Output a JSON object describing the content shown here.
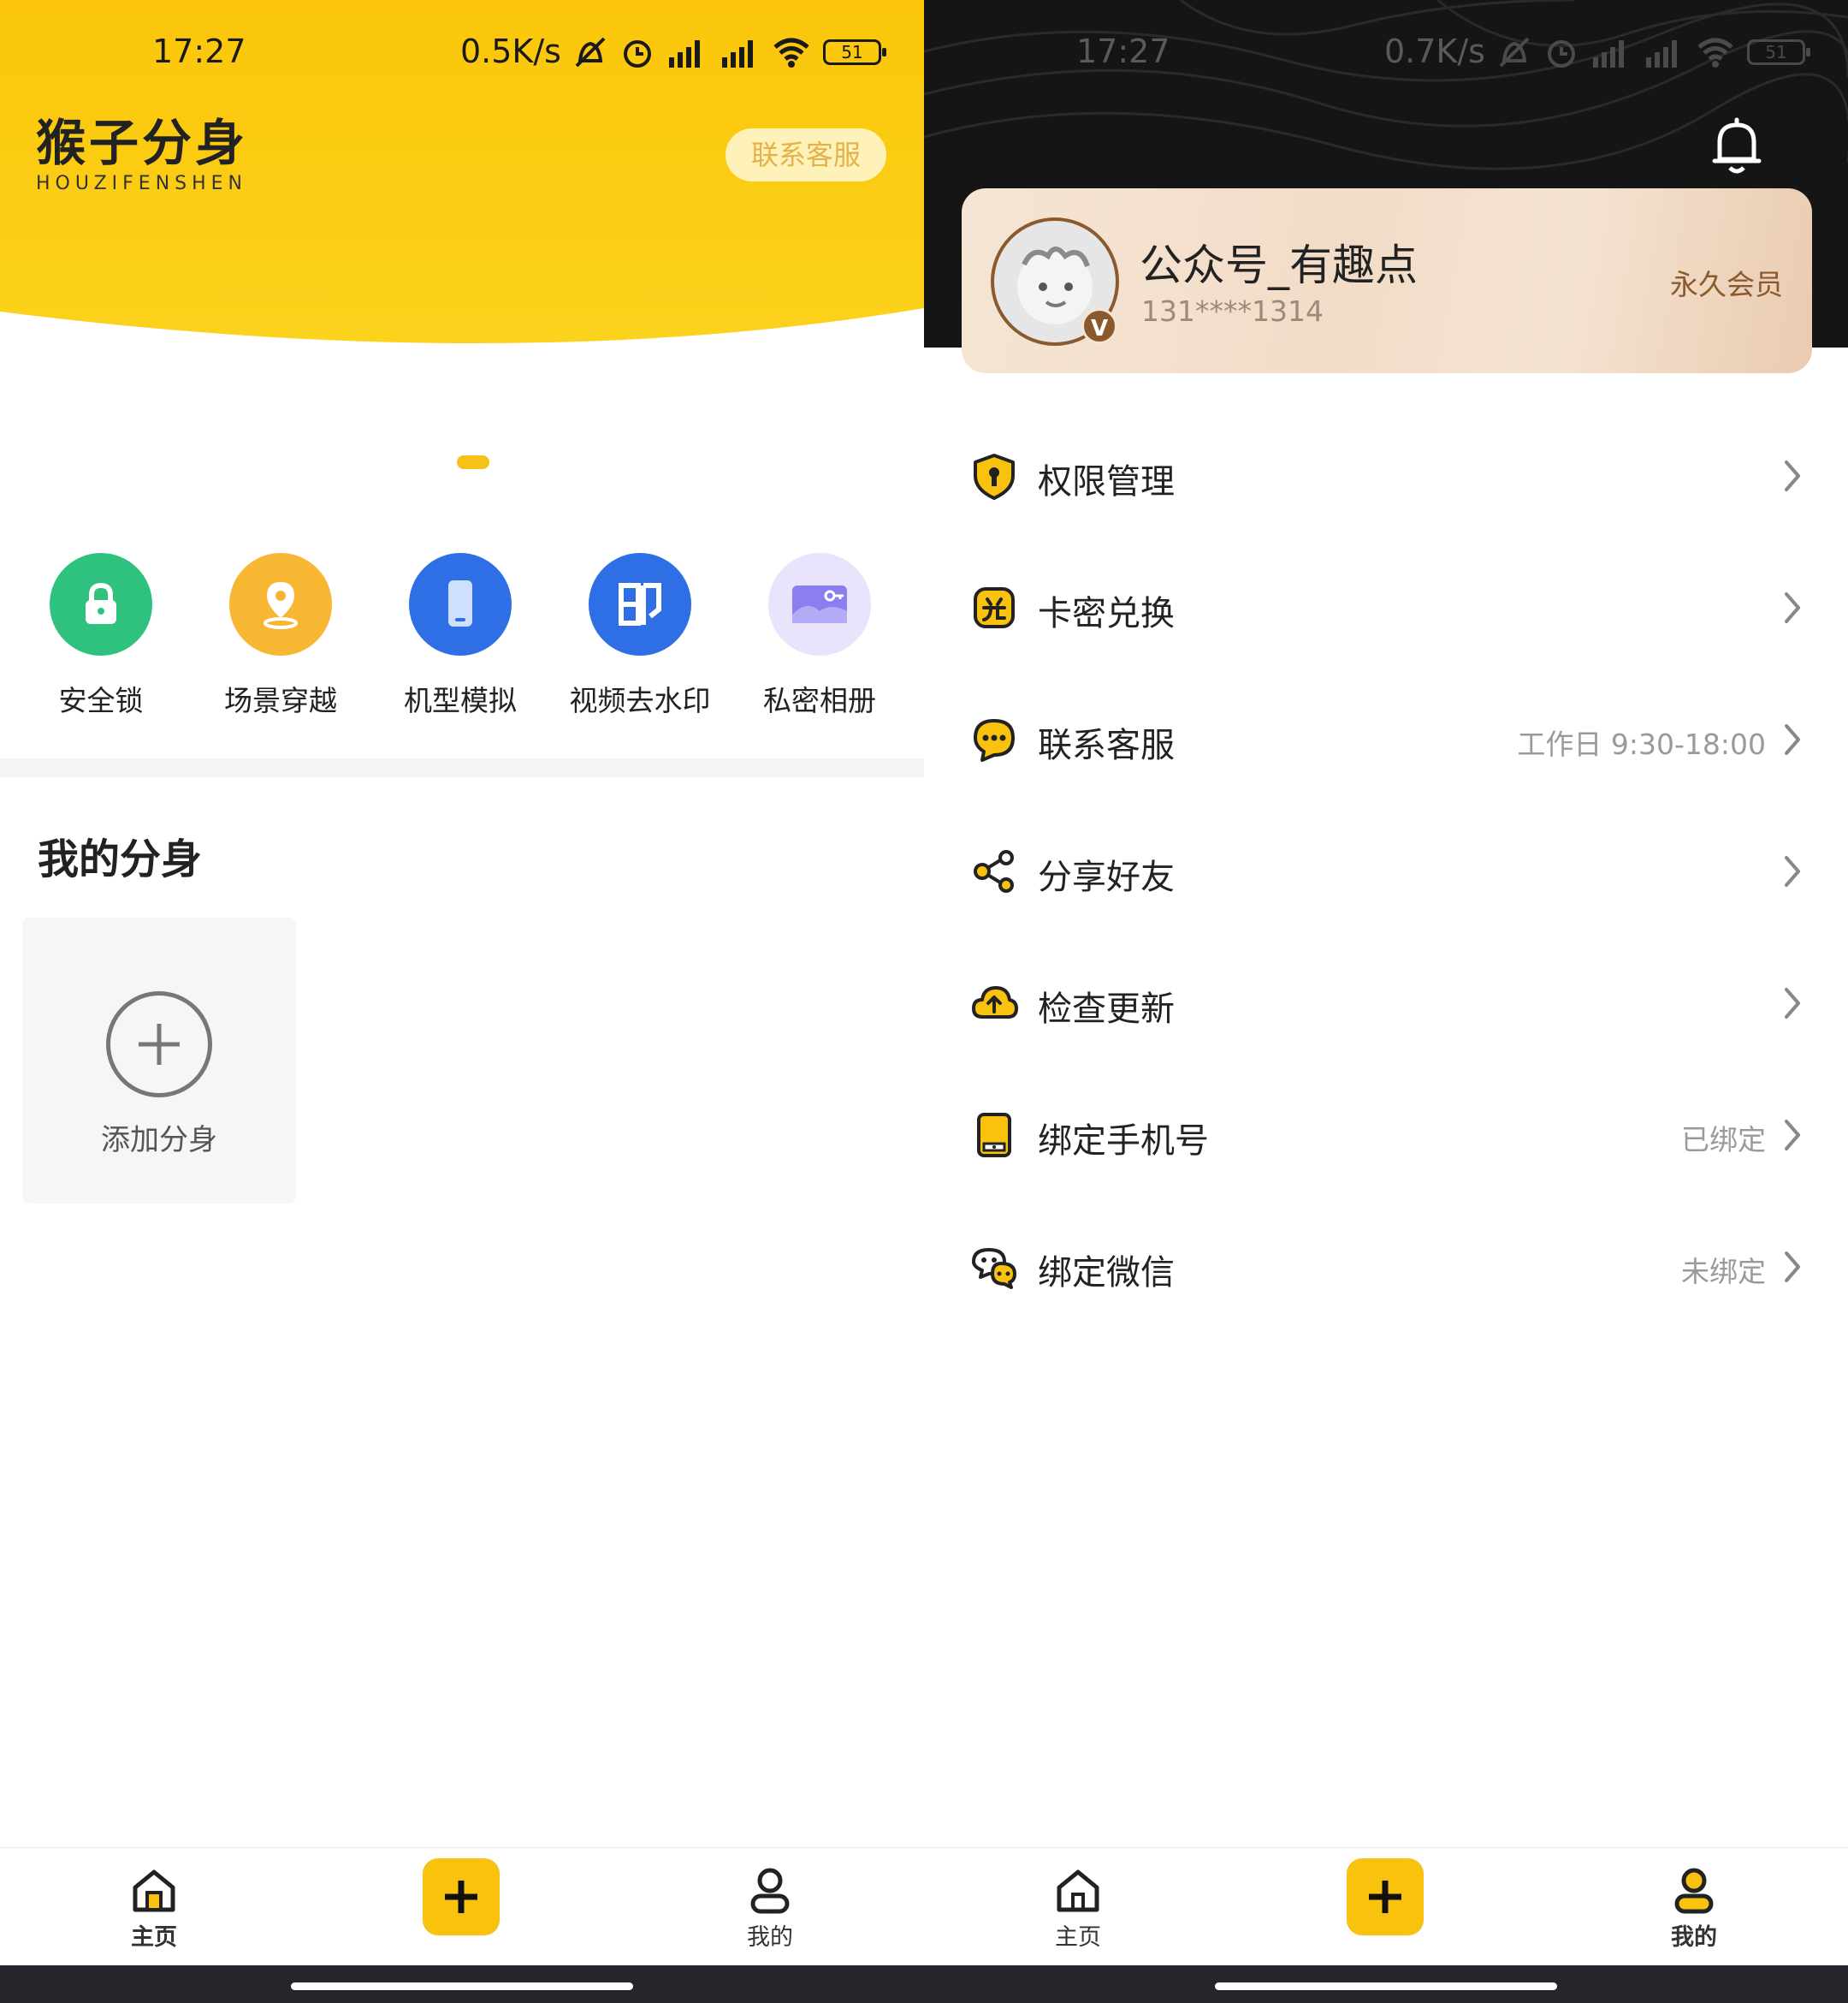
{
  "left_screen": {
    "status_bar": {
      "time": "17:27",
      "net_speed": "0.5K/s",
      "battery": "51"
    },
    "header": {
      "logo_text": "猴子分身",
      "logo_subtext": "HOUZIFENSHEN",
      "contact_button": "联系客服",
      "bg_color": "#f8c20f"
    },
    "shortcuts": [
      {
        "label": "安全锁",
        "icon": "lock-icon",
        "color": "#2ec27e"
      },
      {
        "label": "场景穿越",
        "icon": "location-pin-icon",
        "color": "#f7b733"
      },
      {
        "label": "机型模拟",
        "icon": "phone-device-icon",
        "color": "#2f6fe6"
      },
      {
        "label": "视频去水印",
        "icon": "watermark-icon",
        "color": "#2f6fe6"
      },
      {
        "label": "私密相册",
        "icon": "photo-album-icon",
        "color": "#8b7ff0"
      }
    ],
    "section_title": "我的分身",
    "add_card": {
      "label": "添加分身",
      "icon": "plus-circle-icon"
    }
  },
  "right_screen": {
    "status_bar": {
      "time": "17:27",
      "net_speed": "0.7K/s",
      "battery": "51"
    },
    "profile": {
      "name": "公众号_有趣点",
      "phone": "131****1314",
      "member_tag": "永久会员",
      "badge": "V"
    },
    "menu": [
      {
        "label": "权限管理",
        "value": "",
        "icon": "shield-icon"
      },
      {
        "label": "卡密兑换",
        "value": "",
        "icon": "redeem-icon"
      },
      {
        "label": "联系客服",
        "value": "工作日 9:30-18:00",
        "icon": "chat-bubble-icon"
      },
      {
        "label": "分享好友",
        "value": "",
        "icon": "share-icon"
      },
      {
        "label": "检查更新",
        "value": "",
        "icon": "cloud-upload-icon"
      },
      {
        "label": "绑定手机号",
        "value": "已绑定",
        "icon": "phone-icon"
      },
      {
        "label": "绑定微信",
        "value": "未绑定",
        "icon": "wechat-icon"
      }
    ]
  },
  "bottom_nav": {
    "home_label": "主页",
    "mine_label": "我的",
    "add_icon": "plus-icon",
    "accent": "#f8c20f"
  }
}
